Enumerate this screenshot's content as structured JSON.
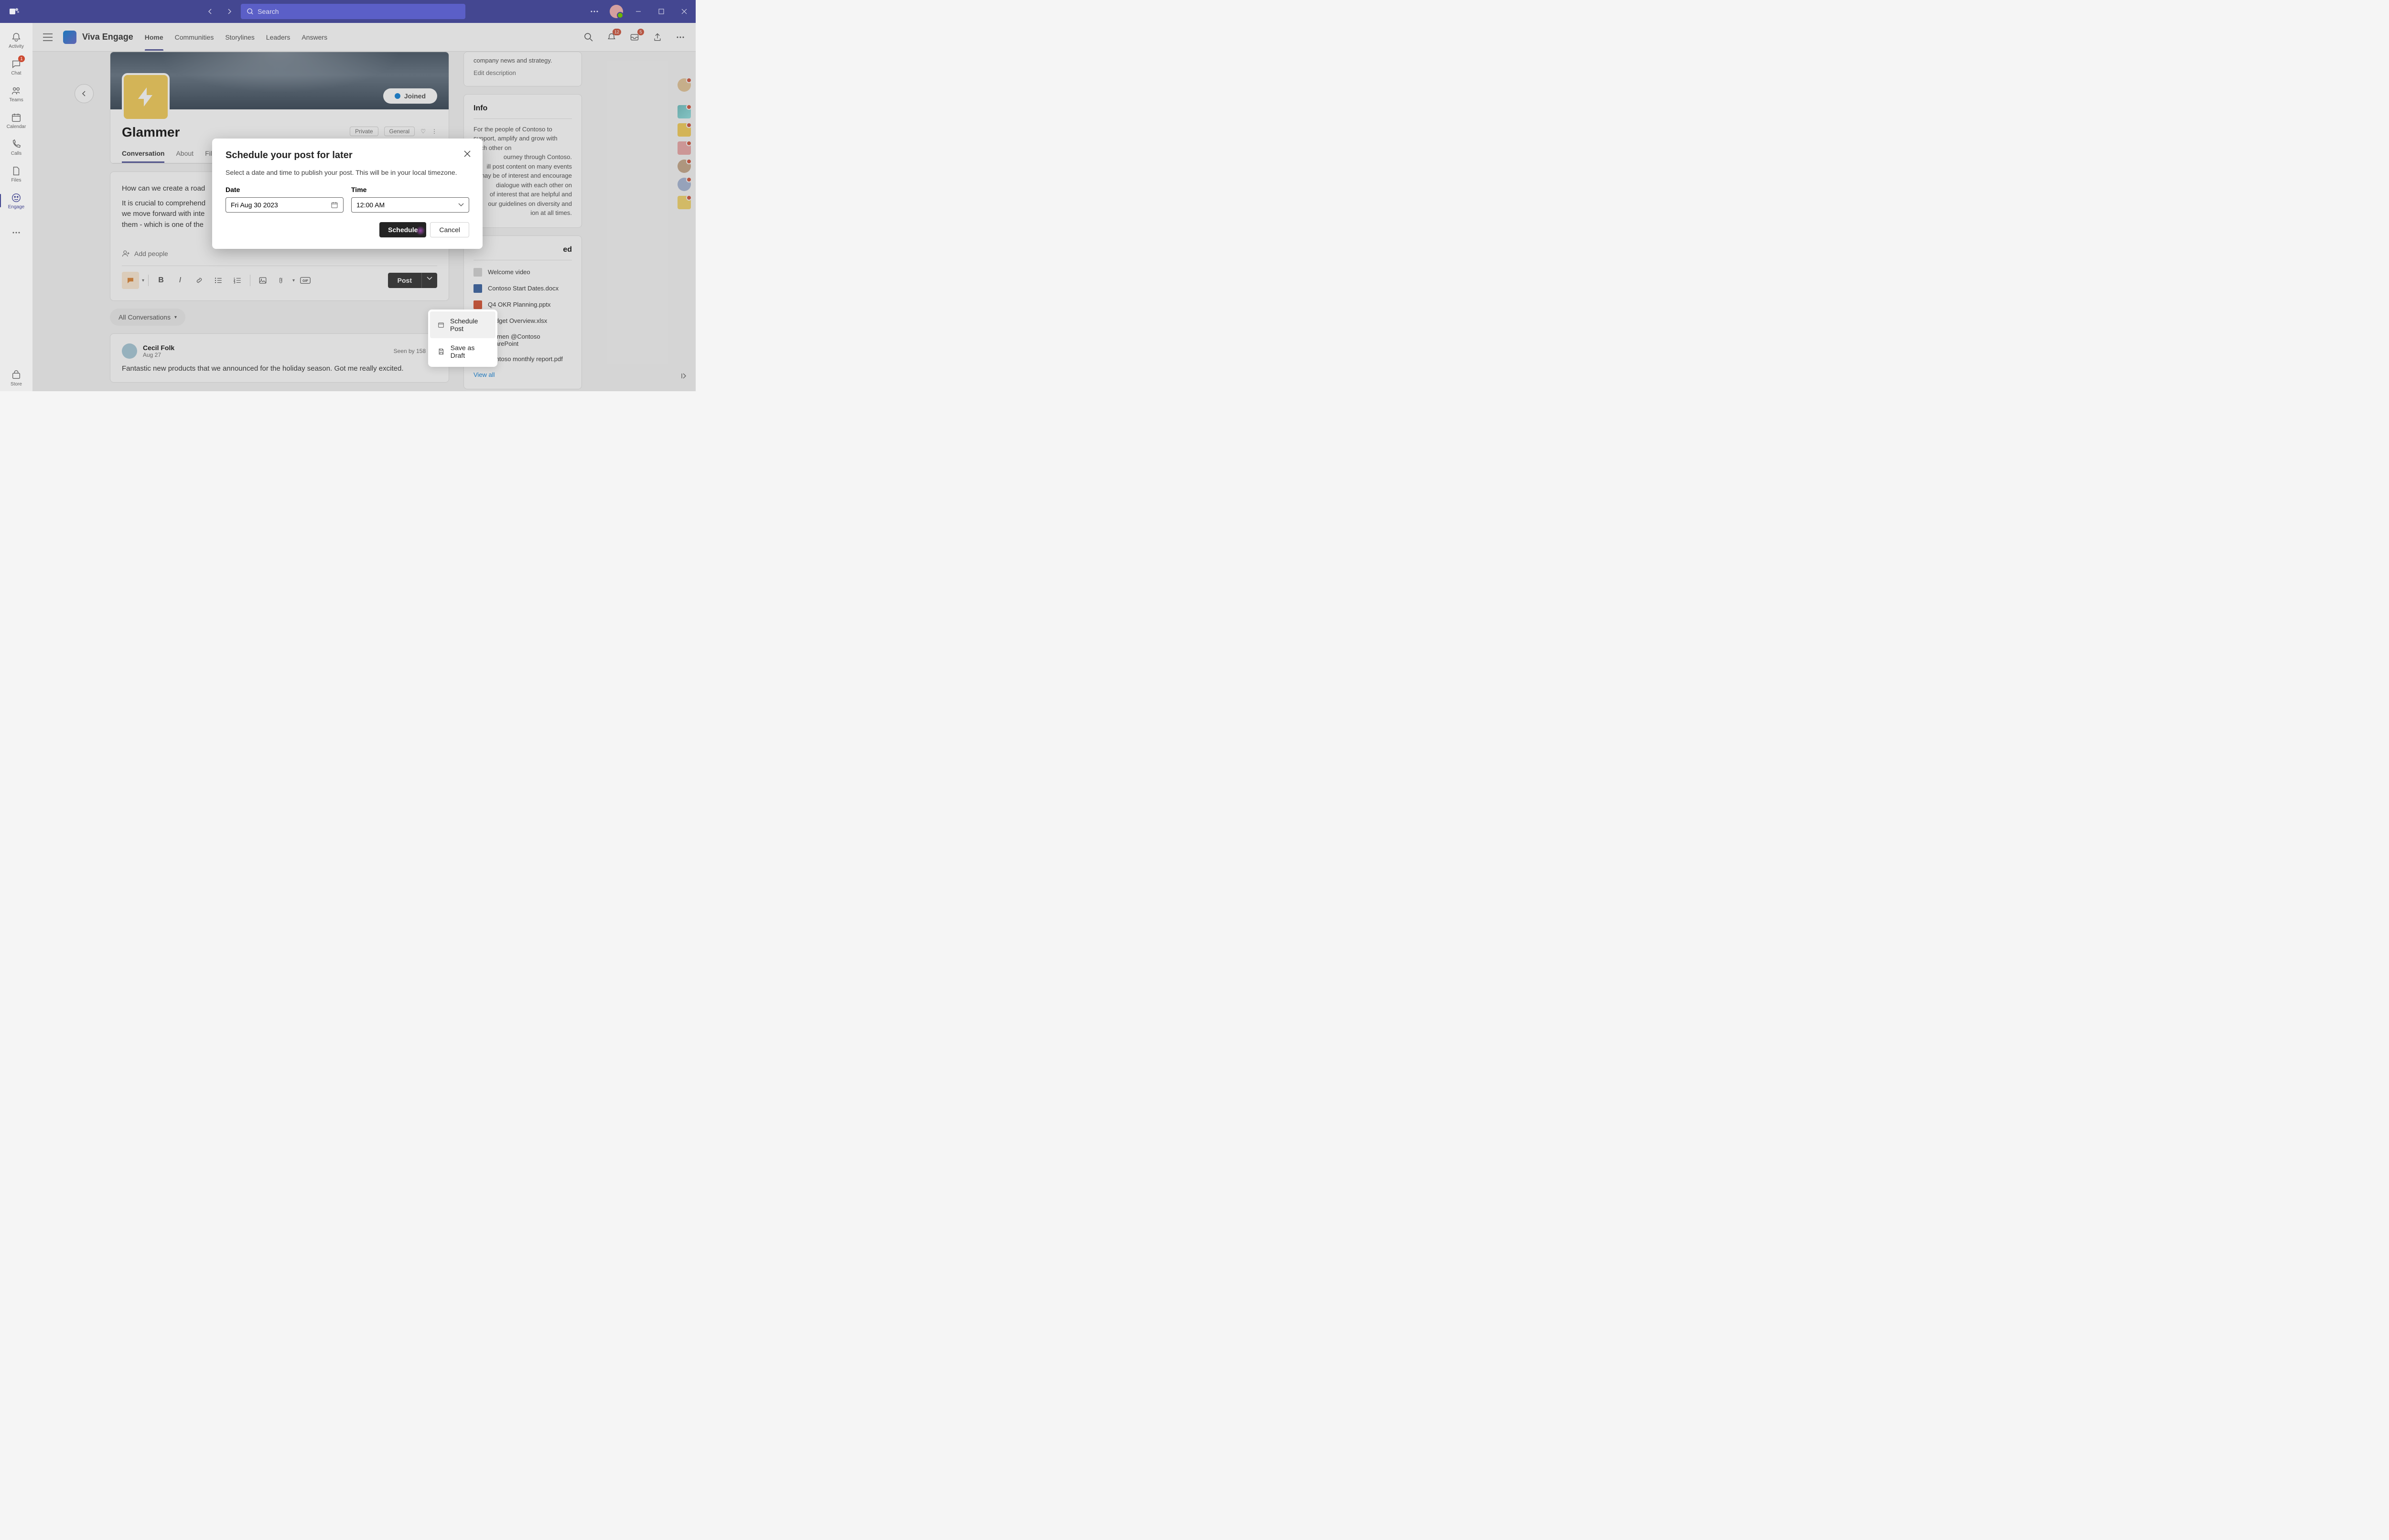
{
  "titlebar": {
    "search_placeholder": "Search"
  },
  "rail": {
    "activity": "Activity",
    "chat": "Chat",
    "chat_badge": "1",
    "teams": "Teams",
    "calendar": "Calendar",
    "calls": "Calls",
    "files": "Files",
    "engage": "Engage",
    "store": "Store"
  },
  "header": {
    "app_title": "Viva Engage",
    "tabs": [
      "Home",
      "Communities",
      "Storylines",
      "Leaders",
      "Answers"
    ],
    "notif_badge": "12",
    "inbox_badge": "5"
  },
  "community": {
    "name": "Glammer",
    "joined_label": "Joined",
    "meta_private": "Private",
    "meta_general": "General",
    "tabs": [
      "Conversation",
      "About",
      "Files"
    ]
  },
  "composer": {
    "text_line1": "How can we create a road",
    "text_line2": "It is crucial to comprehend",
    "text_line3": "we move forward with inte",
    "text_line4": "them - which is one of the",
    "add_people": "Add people",
    "post_label": "Post"
  },
  "post_menu": {
    "schedule": "Schedule Post",
    "draft": "Save as Draft"
  },
  "filter": {
    "label": "All Conversations"
  },
  "feed_post": {
    "author": "Cecil Folk",
    "date": "Aug 27",
    "seen": "Seen by 158",
    "body": "Fantastic new products that we announced for the holiday season. Got me really excited."
  },
  "sidebar": {
    "desc_top": "company news and strategy.",
    "edit": "Edit description",
    "info_heading": "Info",
    "info_p1": "For the people of Contoso to support, amplify and grow with each other on",
    "info_p2": "ourney through Contoso.",
    "info_p3": "ill post content on many events",
    "info_p4": "may be of interest and encourage",
    "info_p5": "dialogue with each other on",
    "info_p6": "of interest that are helpful and",
    "info_p7": "our guidelines on diversity and",
    "info_p8": "ion at all times.",
    "pinned_heading": "ed",
    "pinned_items": [
      {
        "label": "Welcome video",
        "icon": "video"
      },
      {
        "label": "Contoso Start Dates.docx",
        "icon": "word"
      },
      {
        "label": "Q4 OKR Planning.pptx",
        "icon": "ppt"
      },
      {
        "label": "Budget Overview.xlsx",
        "icon": "xls"
      },
      {
        "label": "Women @Contoso SharePoint",
        "icon": "sp"
      },
      {
        "label": "Contoso monthly report.pdf",
        "icon": "pdf"
      }
    ],
    "view_all": "View all"
  },
  "modal": {
    "title": "Schedule your post for later",
    "subtitle": "Select a date and time to publish your post. This will be in your local timezone.",
    "date_label": "Date",
    "date_value": "Fri Aug 30 2023",
    "time_label": "Time",
    "time_value": "12:00 AM",
    "schedule_btn": "Schedule",
    "cancel_btn": "Cancel"
  }
}
